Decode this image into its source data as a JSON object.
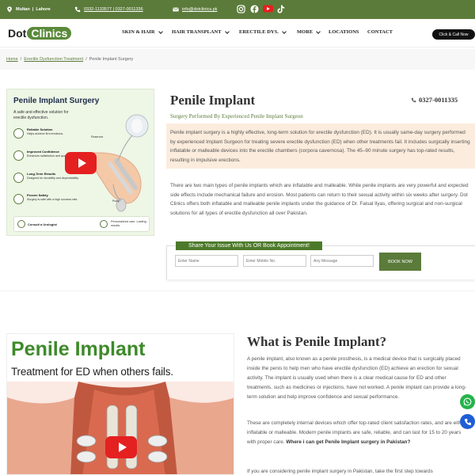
{
  "topbar": {
    "location": "Multan  |  Lahore",
    "phones": "0332-1133577 | 0327-0011336",
    "email": "info@dotclinics.pk",
    "bg_color": "#5b7b3a"
  },
  "social": [
    "instagram-icon",
    "facebook-icon",
    "youtube-icon",
    "tiktok-icon"
  ],
  "logo": {
    "dot": "Dot",
    "clinics": "Clinics"
  },
  "nav": {
    "items": [
      "SKIN & HAIR",
      "HAIR TRANSPLANT",
      "ERECTILE DYS.",
      "MORE",
      "LOCATIONS",
      "CONTACT"
    ],
    "call_button": "Click & Call Now"
  },
  "breadcrumb": [
    "Home",
    "Erectile Dysfunction Treatment",
    "Penile Implant Surgery"
  ],
  "hero_image": {
    "title": "Penile Implant Surgery",
    "subtitle": "A safe and effective solution for erectile dysfunction.",
    "features": [
      {
        "title": "Reliable Solution",
        "text": "Helps achieve firm erections."
      },
      {
        "title": "Improved Confidence",
        "text": "Enhances satisfaction and quality of life."
      },
      {
        "title": "Long-Term Results",
        "text": "Designed for durability and dependability."
      },
      {
        "title": "Proven Safety",
        "text": "Surgery is safe with a high success rate."
      }
    ],
    "footer_left": "Consult a Urologist",
    "footer_right": "Personalized care. Lasting results.",
    "label_reservoir": "Reservoir",
    "label_pump": "Pump"
  },
  "main": {
    "title": "Penile Implant",
    "phone": "0327-0011335",
    "subtitle": "Surgery Performed By Experienced Penile Implant Surgeon",
    "intro": "Penile implant surgery is a highly effective, long-term solution for erectile dysfunction (ED). It is usually same-day surgery performed by experienced Implant Surgeon for treating severe erectile dysfunction (ED) when other treatments fail. It includes surgically inserting inflatable or malleable devices into the erectile chambers (corpora cavernosa). The 45–90 minute surgery has top-rated results, resulting in impulsive erections.",
    "para2": "There are two main types of penile implants which are inflatable and malleable. While penile implants are very powerful and expected side effects include mechanical failure and erosion. Most patients can return to their sexual activity within six weeks after surgery. Dot Clinics offers both inflatable and malleable penile implants under the guidance of Dr. Faisal Ilyas, offering surgical and non-surgical solutions for all types of erectile dysfunction all over Pakistan."
  },
  "form": {
    "heading": "Share Your Issue With Us OR Book Appointment!",
    "name_placeholder": "Enter Name",
    "mobile_placeholder": "Enter Mobile No.",
    "message_placeholder": "Any Message",
    "button": "BOOK NOW"
  },
  "section2": {
    "image_line1": "Penile Implant",
    "image_line2": "Treatment for ED when others fails.",
    "title": "What is Penile Implant?",
    "para1": "A penile implant, also known as a penile prosthesis, is a medical device that is surgically placed inside the penis to help men who have erectile dysfunction (ED) achieve an erection for sexual activity. The implant is usually used when there is a clear medical cause for ED and other treatments, such as medicines or injections, have not worked. A penile implant can provide a long-term solution and help improve confidence and sexual performance.",
    "para2": "These are completely internal devices which offer top-rated client satisfaction rates, and are either inflatable or malleable. Modern penile implants are safe, reliable, and can last for 15 to 20 years with proper care.",
    "para2_bold": "Where i can get Penile Implant surgery in Pakistan?",
    "para3": "If you are considering penile implant surgery in Pakistan, take the first step towards"
  }
}
